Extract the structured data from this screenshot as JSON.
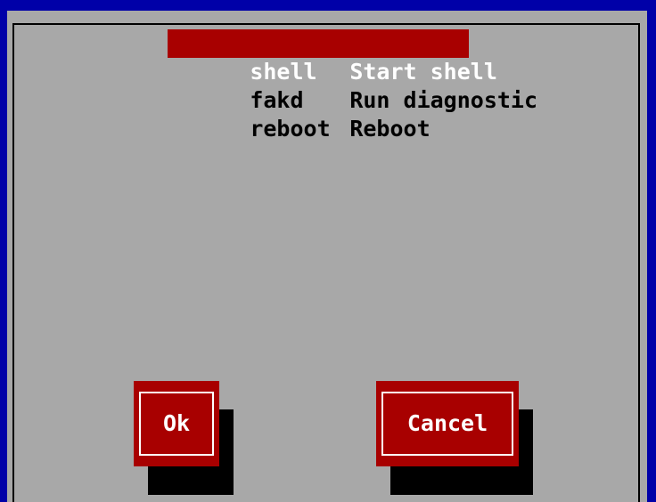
{
  "menu": {
    "items": [
      {
        "key": "shell",
        "description": "Start shell",
        "selected": true
      },
      {
        "key": "fakd",
        "description": "Run diagnostic",
        "selected": false
      },
      {
        "key": "reboot",
        "description": "Reboot",
        "selected": false
      }
    ]
  },
  "buttons": {
    "ok_label": "Ok",
    "cancel_label": "Cancel"
  },
  "colors": {
    "background": "#0000a8",
    "dialog": "#a8a8a8",
    "selection": "#a80000",
    "button": "#a80000",
    "button_text": "#ffffff",
    "shadow": "#000000"
  }
}
